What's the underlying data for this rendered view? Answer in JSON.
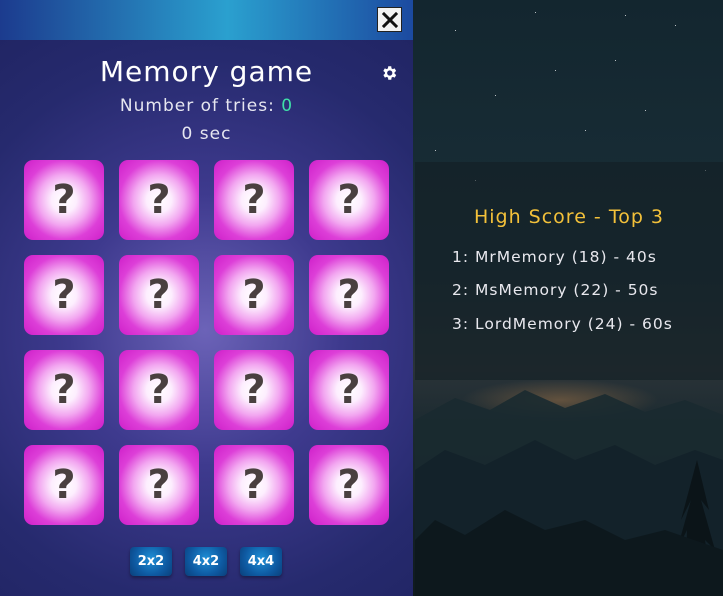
{
  "game": {
    "title": "Memory game",
    "tries_label": "Number of tries: ",
    "tries_count": "0",
    "timer": "0 sec",
    "card_face": "?",
    "cards_count": 16,
    "size_buttons": [
      "2x2",
      "4x2",
      "4x4"
    ],
    "close_icon": "close-icon",
    "settings_icon": "gear-icon"
  },
  "highscore": {
    "title": "High Score - Top 3",
    "entries": [
      "1: MrMemory (18) - 40s",
      "2: MsMemory (22) - 50s",
      "3: LordMemory (24) - 60s"
    ]
  },
  "colors": {
    "tries_count": "#3fe0a8",
    "highscore_title": "#f3c13a",
    "card": "#cf1ec9",
    "size_button": "#0e5aa2"
  }
}
